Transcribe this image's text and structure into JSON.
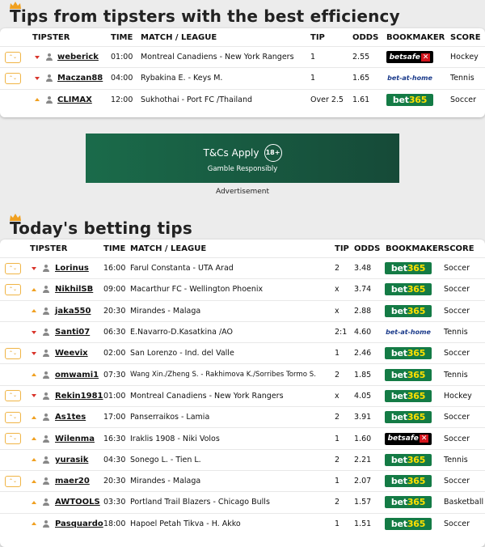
{
  "section1": {
    "title": "Tips from tipsters with the best efficiency",
    "headers": [
      "TIPSTER",
      "TIME",
      "MATCH / LEAGUE",
      "TIP",
      "ODDS",
      "BOOKMAKER",
      "SCORE"
    ],
    "rows": [
      {
        "btn": true,
        "trend": "down",
        "tipster": "weberick",
        "time": "01:00",
        "match": "Montreal Canadiens - New York Rangers",
        "tip": "1",
        "odds": "2.55",
        "bookmaker": "betsafe",
        "score": "Hockey"
      },
      {
        "btn": true,
        "trend": "down",
        "tipster": "Maczan88",
        "time": "04:00",
        "match": "Rybakina E. - Keys M.",
        "tip": "1",
        "odds": "1.65",
        "bookmaker": "bet-at-home",
        "score": "Tennis"
      },
      {
        "btn": false,
        "trend": "up",
        "tipster": "CLIMAX",
        "time": "12:00",
        "match": "Sukhothai - Port FC /Thailand",
        "tip": "Over 2.5",
        "odds": "1.61",
        "bookmaker": "bet365",
        "score": "Soccer"
      }
    ]
  },
  "ad": {
    "line1": "T&Cs Apply",
    "badge": "18+",
    "line2": "Gamble Responsibly",
    "label": "Advertisement"
  },
  "section2": {
    "title": "Today's betting tips",
    "headers": [
      "TIPSTER",
      "TIME",
      "MATCH / LEAGUE",
      "TIP",
      "ODDS",
      "BOOKMAKER",
      "SCORE"
    ],
    "rows": [
      {
        "btn": true,
        "trend": "down",
        "tipster": "Lorinus",
        "time": "16:00",
        "match": "Farul Constanta - UTA Arad",
        "tip": "2",
        "odds": "3.48",
        "bookmaker": "bet365",
        "score": "Soccer"
      },
      {
        "btn": true,
        "trend": "up",
        "tipster": "NikhilSB",
        "time": "09:00",
        "match": "Macarthur FC - Wellington Phoenix",
        "tip": "x",
        "odds": "3.74",
        "bookmaker": "bet365",
        "score": "Soccer"
      },
      {
        "btn": false,
        "trend": "up",
        "tipster": "jaka550",
        "time": "20:30",
        "match": "Mirandes - Malaga",
        "tip": "x",
        "odds": "2.88",
        "bookmaker": "bet365",
        "score": "Soccer"
      },
      {
        "btn": false,
        "trend": "down",
        "tipster": "Santi07",
        "time": "06:30",
        "match": "E.Navarro-D.Kasatkina /AO",
        "tip": "2:1",
        "odds": "4.60",
        "bookmaker": "bet-at-home",
        "score": "Tennis"
      },
      {
        "btn": true,
        "trend": "down",
        "tipster": "Weevix",
        "time": "02:00",
        "match": "San Lorenzo - Ind. del Valle",
        "tip": "1",
        "odds": "2.46",
        "bookmaker": "bet365",
        "score": "Soccer"
      },
      {
        "btn": false,
        "trend": "up",
        "tipster": "omwami1",
        "time": "07:30",
        "match": "Wang Xin./Zheng S. - Rakhimova K./Sorribes Tormo S.",
        "tip": "2",
        "odds": "1.85",
        "bookmaker": "bet365",
        "score": "Tennis"
      },
      {
        "btn": true,
        "trend": "down",
        "tipster": "Rekin1981",
        "time": "01:00",
        "match": "Montreal Canadiens - New York Rangers",
        "tip": "x",
        "odds": "4.05",
        "bookmaker": "bet365",
        "score": "Hockey"
      },
      {
        "btn": true,
        "trend": "up",
        "tipster": "As1tes",
        "time": "17:00",
        "match": "Panserraikos - Lamia",
        "tip": "2",
        "odds": "3.91",
        "bookmaker": "bet365",
        "score": "Soccer"
      },
      {
        "btn": true,
        "trend": "up",
        "tipster": "Wilenma",
        "time": "16:30",
        "match": "Iraklis 1908 - Niki Volos",
        "tip": "1",
        "odds": "1.60",
        "bookmaker": "betsafe",
        "score": "Soccer"
      },
      {
        "btn": false,
        "trend": "up",
        "tipster": "yurasik",
        "time": "04:30",
        "match": "Sonego L. - Tien L.",
        "tip": "2",
        "odds": "2.21",
        "bookmaker": "bet365",
        "score": "Tennis"
      },
      {
        "btn": true,
        "trend": "up",
        "tipster": "maer20",
        "time": "20:30",
        "match": "Mirandes - Malaga",
        "tip": "1",
        "odds": "2.07",
        "bookmaker": "bet365",
        "score": "Soccer"
      },
      {
        "btn": false,
        "trend": "up",
        "tipster": "AWTOOLS",
        "time": "03:30",
        "match": "Portland Trail Blazers - Chicago Bulls",
        "tip": "2",
        "odds": "1.57",
        "bookmaker": "bet365",
        "score": "Basketball"
      },
      {
        "btn": false,
        "trend": "up",
        "tipster": "Pasquardo",
        "time": "18:00",
        "match": "Hapoel Petah Tikva - H. Akko",
        "tip": "1",
        "odds": "1.51",
        "bookmaker": "bet365",
        "score": "Soccer"
      }
    ]
  },
  "icons": {
    "expand": "chevron-double-icon",
    "trend_up": "arrow-up-icon",
    "trend_down": "arrow-down-icon",
    "user": "user-icon",
    "crown": "crown-icon"
  },
  "colors": {
    "bet365_bg": "#147b45",
    "bet365_accent": "#ffe000",
    "betsafe_bg": "#000000",
    "betsafe_x": "#d4141c",
    "bet_at_home": "#1a3a8a",
    "trend_up": "#f0a020",
    "trend_down": "#d9342b",
    "button_border": "#f0b445"
  }
}
